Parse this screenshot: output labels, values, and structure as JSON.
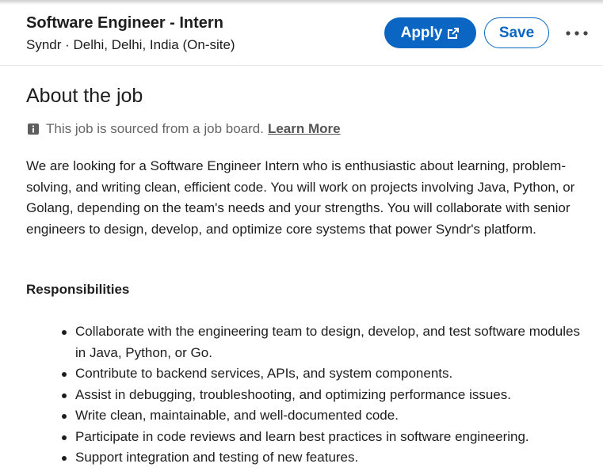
{
  "header": {
    "job_title": "Software Engineer - Intern",
    "company_location": "Syndr · Delhi, Delhi, India (On-site)",
    "apply_label": "Apply",
    "save_label": "Save",
    "apply_icon": "external-link-icon",
    "more_icon": "more-horizontal-icon"
  },
  "about": {
    "title": "About the job",
    "source_note": "This job is sourced from a job board.",
    "learn_more": "Learn More",
    "intro": "We are looking for a Software Engineer Intern who is enthusiastic about learning, problem-solving, and writing clean, efficient code. You will work on projects involving Java, Python, or Golang, depending on the team's needs and your strengths. You will collaborate with senior engineers to design, develop, and optimize core systems that power Syndr's platform.",
    "responsibilities_heading": "Responsibilities",
    "responsibilities": [
      "Collaborate with the engineering team to design, develop, and test software modules in Java, Python, or Go.",
      "Contribute to backend services, APIs, and system components.",
      "Assist in debugging, troubleshooting, and optimizing performance issues.",
      "Write clean, maintainable, and well-documented code.",
      "Participate in code reviews and learn best practices in software engineering.",
      "Support integration and testing of new features."
    ]
  },
  "colors": {
    "primary": "#0a66c2",
    "text": "#1d1d1d",
    "muted": "#666666"
  }
}
